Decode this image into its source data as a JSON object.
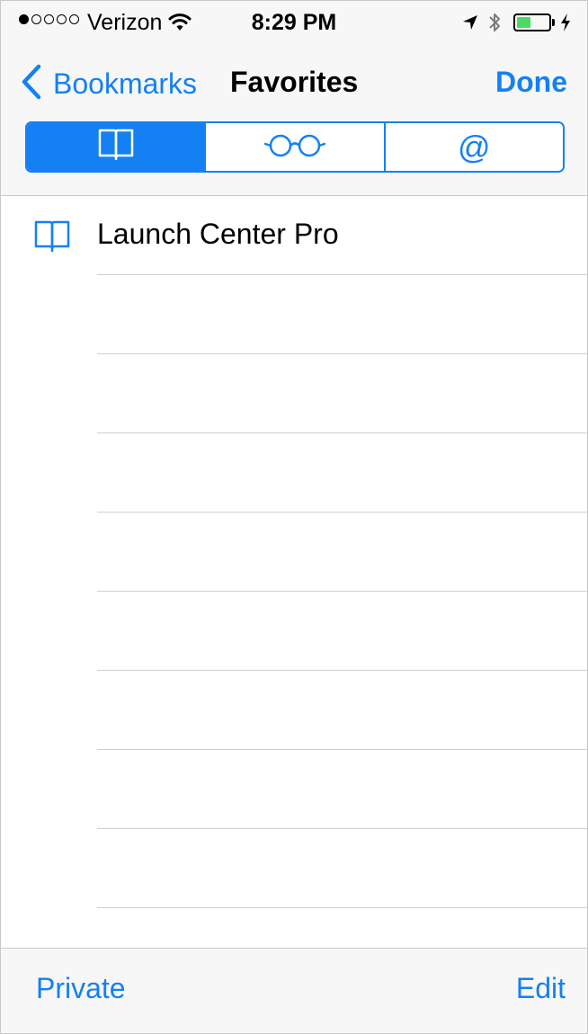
{
  "status_bar": {
    "carrier": "Verizon",
    "time": "8:29 PM",
    "signal_bars_filled": 1,
    "signal_bars_total": 5,
    "battery_level": 0.45,
    "battery_color": "#4cd964"
  },
  "nav": {
    "back_label": "Bookmarks",
    "title": "Favorites",
    "done_label": "Done"
  },
  "segments": {
    "items": [
      {
        "icon": "book-icon",
        "selected": true
      },
      {
        "icon": "glasses-icon",
        "selected": false
      },
      {
        "icon": "at-icon",
        "glyph": "@",
        "selected": false
      }
    ]
  },
  "bookmarks": {
    "items": [
      {
        "label": "Launch Center Pro",
        "icon": "book-icon"
      }
    ]
  },
  "toolbar": {
    "private_label": "Private",
    "edit_label": "Edit"
  },
  "colors": {
    "accent": "#1580f4",
    "chrome_background": "#f7f7f7",
    "separator": "#cfcfd3"
  }
}
